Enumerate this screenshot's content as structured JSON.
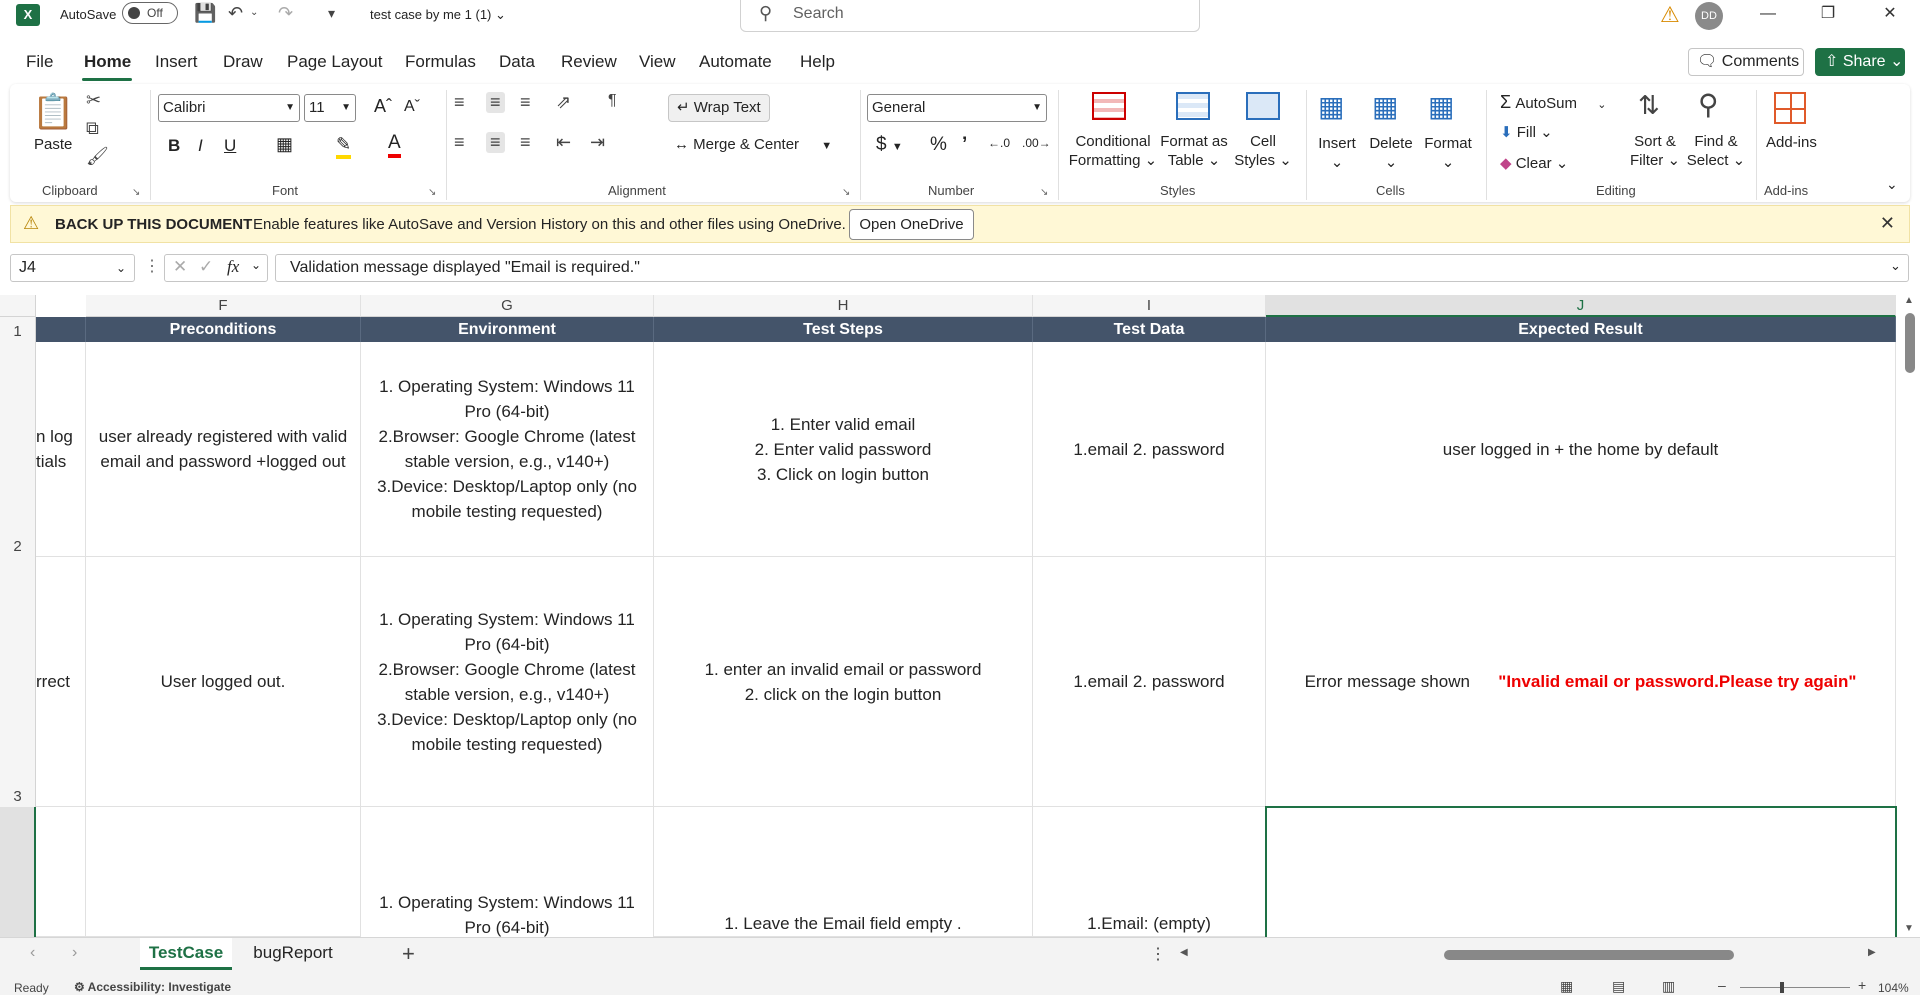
{
  "titlebar": {
    "autosave_label": "AutoSave",
    "autosave_state": "Off",
    "file_name": "test case by me 1 (1)",
    "search_placeholder": "Search",
    "avatar_initials": "DD"
  },
  "menu": [
    "File",
    "Home",
    "Insert",
    "Draw",
    "Page Layout",
    "Formulas",
    "Data",
    "Review",
    "View",
    "Automate",
    "Help"
  ],
  "menu_active": "Home",
  "actions": {
    "comments": "Comments",
    "share": "Share"
  },
  "ribbon": {
    "clipboard": {
      "paste": "Paste",
      "label": "Clipboard"
    },
    "font": {
      "name": "Calibri",
      "size": "11",
      "label": "Font"
    },
    "alignment": {
      "wrap_text": "Wrap Text",
      "merge_center": "Merge & Center",
      "label": "Alignment"
    },
    "number": {
      "format": "General",
      "label": "Number"
    },
    "styles": {
      "conditional": "Conditional Formatting",
      "format_table": "Format as Table",
      "cell_styles": "Cell Styles",
      "label": "Styles"
    },
    "cells": {
      "insert": "Insert",
      "delete": "Delete",
      "format": "Format",
      "label": "Cells"
    },
    "editing": {
      "autosum": "AutoSum",
      "fill": "Fill",
      "clear": "Clear",
      "sort_filter": "Sort & Filter",
      "find_select": "Find & Select",
      "label": "Editing"
    },
    "addins": {
      "addins": "Add-ins",
      "label": "Add-ins"
    }
  },
  "infobar": {
    "title": "BACK UP THIS DOCUMENT",
    "message": "Enable features like AutoSave and Version History on this and other files using OneDrive.",
    "button": "Open OneDrive"
  },
  "formula_bar": {
    "name_box": "J4",
    "formula": "Validation message displayed  \"Email is required.\""
  },
  "grid": {
    "columns": [
      "F",
      "G",
      "H",
      "I",
      "J"
    ],
    "rows": [
      "1",
      "2",
      "3"
    ],
    "headers": [
      "Preconditions",
      "Environment",
      "Test Steps",
      "Test Data",
      "Expected Result"
    ],
    "row2": {
      "e_partial": "n log\ntials",
      "f": "user already registered with valid\nemail and password +logged out",
      "g": "1. Operating System: Windows 11\nPro (64-bit)\n2.Browser: Google Chrome (latest\nstable version, e.g., v140+)\n3.Device: Desktop/Laptop only (no\nmobile testing requested)",
      "h": "1. Enter valid email\n2. Enter valid password\n3. Click on login button",
      "i": "1.email 2. password",
      "j": "user logged in  + the home by default"
    },
    "row3": {
      "e_partial": "rrect",
      "f": "User logged out.",
      "g": "1. Operating System: Windows 11\nPro (64-bit)\n2.Browser: Google Chrome (latest\nstable version, e.g., v140+)\n3.Device: Desktop/Laptop only (no\nmobile testing requested)",
      "h": "1. enter an invalid email or password\n2. click on the login button",
      "i": "1.email 2. password",
      "j_plain": "Error message shown      ",
      "j_red": "\"Invalid email or password.Please try again\""
    },
    "row4": {
      "g": "1. Operating System: Windows 11\nPro (64-bit)",
      "h": "1. Leave the Email field empty .",
      "i": "1.Email: (empty)"
    }
  },
  "sheets": [
    "TestCase",
    "bugReport"
  ],
  "active_sheet": "TestCase",
  "status": {
    "ready": "Ready",
    "accessibility": "Accessibility: Investigate",
    "zoom": "104%"
  },
  "colors": {
    "accent": "#1e7145",
    "header_fill": "#44546a",
    "error_red": "#ee0000"
  }
}
